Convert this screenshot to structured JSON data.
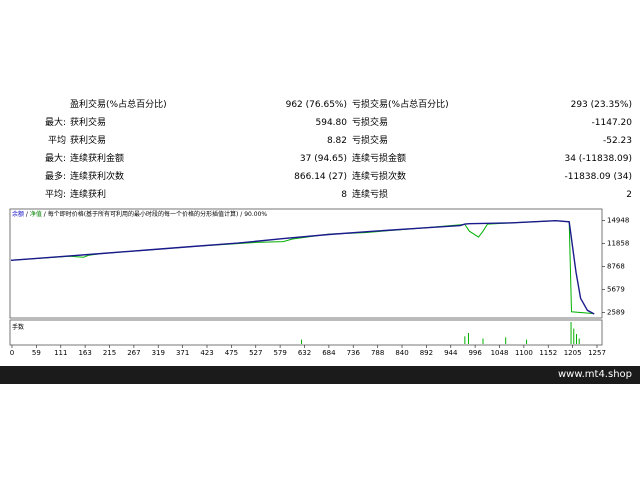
{
  "stats": [
    {
      "prefix": "",
      "left_label": "盈利交易(%占总百分比)",
      "left_value": "962 (76.65%)",
      "right_label": "亏损交易(%占总百分比)",
      "right_value": "293 (23.35%)"
    },
    {
      "prefix": "最大:",
      "left_label": "获利交易",
      "left_value": "594.80",
      "right_label": "亏损交易",
      "right_value": "-1147.20"
    },
    {
      "prefix": "平均",
      "left_label": "获利交易",
      "left_value": "8.82",
      "right_label": "亏损交易",
      "right_value": "-52.23"
    },
    {
      "prefix": "最大:",
      "left_label": "连续获利金额",
      "left_value": "37 (94.65)",
      "right_label": "连续亏损金额",
      "right_value": "34 (-11838.09)"
    },
    {
      "prefix": "最多:",
      "left_label": "连续获利次数",
      "left_value": "866.14 (27)",
      "right_label": "连续亏损次数",
      "right_value": "-11838.09 (34)"
    },
    {
      "prefix": "平均:",
      "left_label": "连续获利",
      "left_value": "8",
      "right_label": "连续亏损",
      "right_value": "2"
    }
  ],
  "chart_caption": {
    "balance": "余额",
    "sep1": " / ",
    "equity": "净值",
    "rest": " / 每个即时价格(基于所有可利用的最小时段的每一个价格的分形插值计算) / 90.00%"
  },
  "volume_label": "手数",
  "footer": {
    "text": "www.mt4.shop"
  },
  "colors": {
    "balance": "#1a1a8c",
    "equity": "#00b000",
    "footer_bg": "#1b1b1b"
  },
  "chart_data": {
    "type": "line",
    "title": "",
    "xlabel": "",
    "ylabel": "",
    "x_ticks": [
      "0",
      "59",
      "111",
      "163",
      "215",
      "267",
      "319",
      "371",
      "423",
      "475",
      "527",
      "579",
      "632",
      "684",
      "736",
      "788",
      "840",
      "892",
      "944",
      "996",
      "1048",
      "1100",
      "1152",
      "1205",
      "1257"
    ],
    "y_ticks": [
      14948,
      11858,
      8768,
      5679,
      2589
    ],
    "ylim": [
      2000,
      16200
    ],
    "xlim": [
      0,
      1300
    ],
    "grid": false,
    "series": [
      {
        "name": "余额",
        "x": [
          0,
          100,
          200,
          300,
          400,
          500,
          600,
          700,
          800,
          900,
          990,
          1000,
          1010,
          1100,
          1150,
          1200,
          1230,
          1245,
          1255,
          1270,
          1285
        ],
        "y": [
          9600,
          10050,
          10500,
          10980,
          11450,
          11900,
          12500,
          13050,
          13500,
          13900,
          14250,
          14450,
          14500,
          14600,
          14750,
          14900,
          14750,
          8000,
          4500,
          2900,
          2400
        ]
      },
      {
        "name": "净值",
        "x": [
          0,
          130,
          160,
          170,
          200,
          320,
          400,
          540,
          600,
          620,
          700,
          780,
          900,
          1000,
          1010,
          1030,
          1040,
          1050,
          1100,
          1200,
          1230,
          1235,
          1285
        ],
        "y": [
          9600,
          10150,
          10000,
          10250,
          10500,
          11050,
          11450,
          12000,
          12100,
          12450,
          13100,
          13300,
          13900,
          14400,
          13500,
          12700,
          13500,
          14450,
          14600,
          14900,
          14750,
          2700,
          2450
        ]
      }
    ],
    "volume": {
      "x": [
        640,
        1000,
        1008,
        1040,
        1090,
        1136,
        1234,
        1240,
        1246,
        1252
      ],
      "y": [
        0.2,
        0.35,
        0.5,
        0.25,
        0.3,
        0.2,
        1.0,
        0.7,
        0.45,
        0.25
      ]
    }
  }
}
